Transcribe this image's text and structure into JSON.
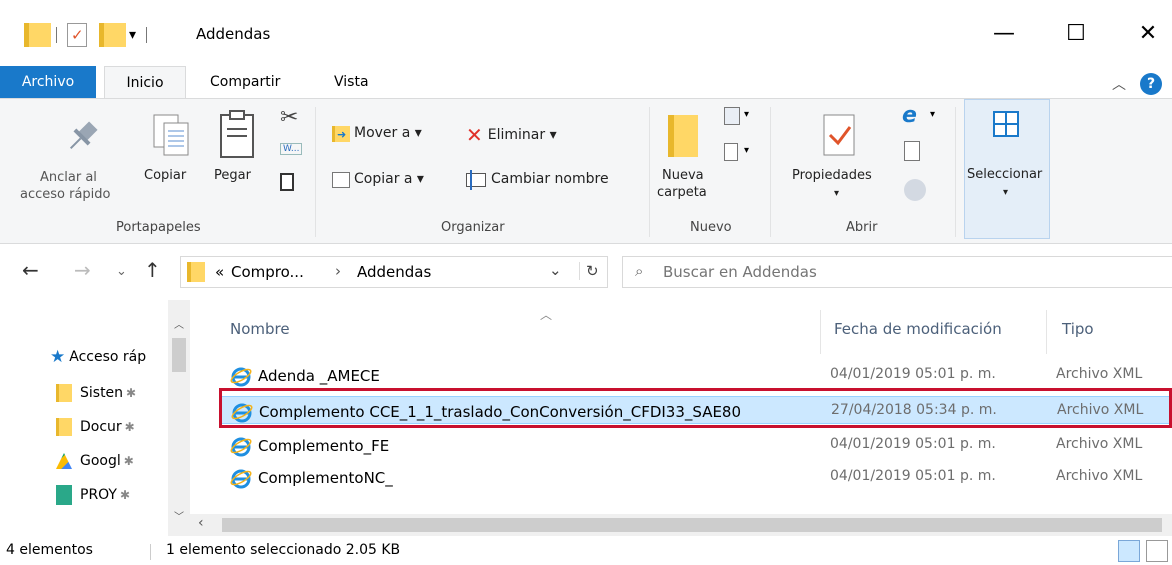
{
  "window": {
    "title": "Addendas",
    "minimize": "—",
    "maximize": "☐",
    "close": "✕"
  },
  "tabs": {
    "file": "Archivo",
    "home": "Inicio",
    "share": "Compartir",
    "view": "Vista"
  },
  "ribbon": {
    "clipboard": {
      "group": "Portapapeles",
      "pin_line1": "Anclar al",
      "pin_line2": "acceso rápido",
      "copy": "Copiar",
      "paste": "Pegar"
    },
    "organize": {
      "group": "Organizar",
      "move": "Mover a ▾",
      "copy_to": "Copiar a ▾",
      "delete": "Eliminar ▾",
      "rename": "Cambiar nombre"
    },
    "new": {
      "group": "Nuevo",
      "folder_line1": "Nueva",
      "folder_line2": "carpeta"
    },
    "open": {
      "group": "Abrir",
      "properties": "Propiedades",
      "properties_arrow": "▾"
    },
    "select": {
      "label": "Seleccionar",
      "arrow": "▾"
    }
  },
  "address": {
    "overflow": "«",
    "crumb1": "Compro...",
    "sep": "›",
    "crumb2": "Addendas",
    "dropdown": "⌄",
    "refresh": "↻",
    "search_placeholder": "Buscar en Addendas"
  },
  "navpane": {
    "quick_access": "Acceso ráp",
    "items": [
      "Sisten",
      "Docur",
      "Googl",
      "PROY"
    ]
  },
  "columns": {
    "name": "Nombre",
    "date": "Fecha de modificación",
    "type": "Tipo"
  },
  "files": [
    {
      "name": "Adenda _AMECE",
      "date": "04/01/2019 05:01 p. m.",
      "type": "Archivo XML"
    },
    {
      "name": "Complemento CCE_1_1_traslado_ConConversión_CFDI33_SAE80",
      "date": "27/04/2018 05:34 p. m.",
      "type": "Archivo XML"
    },
    {
      "name": "Complemento_FE",
      "date": "04/01/2019 05:01 p. m.",
      "type": "Archivo XML"
    },
    {
      "name": "ComplementoNC_",
      "date": "04/01/2019 05:01 p. m.",
      "type": "Archivo XML"
    }
  ],
  "status": {
    "count": "4 elementos",
    "selection": "1 elemento seleccionado  2.05 KB"
  },
  "colors": {
    "accent": "#1979ca",
    "selection": "#cce8ff",
    "highlight": "#c8102e",
    "folder": "#ffd766"
  }
}
